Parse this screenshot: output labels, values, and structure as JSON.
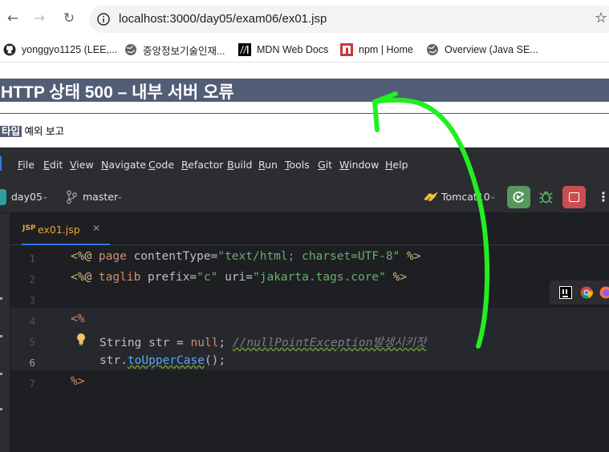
{
  "browser": {
    "url": "localhost:3000/day05/exam06/ex01.jsp",
    "bookmarks": [
      {
        "label": "yonggyo1125 (LEE,...",
        "icon": "github-icon"
      },
      {
        "label": "중앙정보기술인재...",
        "icon": "globe-icon"
      },
      {
        "label": "MDN Web Docs",
        "icon": "mdn-icon"
      },
      {
        "label": "npm | Home",
        "icon": "npm-icon"
      },
      {
        "label": "Overview (Java SE...",
        "icon": "globe-icon"
      }
    ]
  },
  "error_page": {
    "title": "HTTP 상태 500 – 내부 서버 오류",
    "type_label": "타입",
    "type_value": " 예외 보고"
  },
  "ide": {
    "menu": [
      {
        "u": "F",
        "rest": "ile"
      },
      {
        "u": "E",
        "rest": "dit"
      },
      {
        "u": "V",
        "rest": "iew"
      },
      {
        "u": "N",
        "rest": "avigate"
      },
      {
        "u": "C",
        "rest": "ode"
      },
      {
        "u": "R",
        "rest": "efactor"
      },
      {
        "u": "B",
        "rest": "uild"
      },
      {
        "u": "R",
        "rest": "un"
      },
      {
        "u": "T",
        "rest": "ools"
      },
      {
        "u": "G",
        "rest": "it"
      },
      {
        "u": "W",
        "rest": "indow"
      },
      {
        "u": "H",
        "rest": "elp"
      }
    ],
    "project": "day05",
    "branch": "master",
    "run_config": "Tomcat10",
    "file_tab": {
      "type": "JSP",
      "name": "ex01.jsp"
    },
    "line_numbers": [
      "1",
      "2",
      "3",
      "4",
      "5",
      "6",
      "7"
    ],
    "code": {
      "l1_a": "<%@ ",
      "l1_b": "page",
      "l1_c": " contentType=",
      "l1_d": "\"text/html; charset=UTF-8\"",
      "l1_e": " %>",
      "l2_a": "<%@ ",
      "l2_b": "taglib",
      "l2_c": " prefix=",
      "l2_d": "\"c\"",
      "l2_e": " uri=",
      "l2_f": "\"jakarta.tags.core\"",
      "l2_g": " %>",
      "l4": "<%",
      "l5_a": "String str = ",
      "l5_b": "null",
      "l5_c": "; ",
      "l5_d": "//nullPointException발생시키잣",
      "l6_a": "str.",
      "l6_b": "toUpperCase",
      "l6_c": "();",
      "l7": "%>"
    }
  },
  "colors": {
    "error_header": "#525d76",
    "annotation_arrow": "#22ee22"
  }
}
